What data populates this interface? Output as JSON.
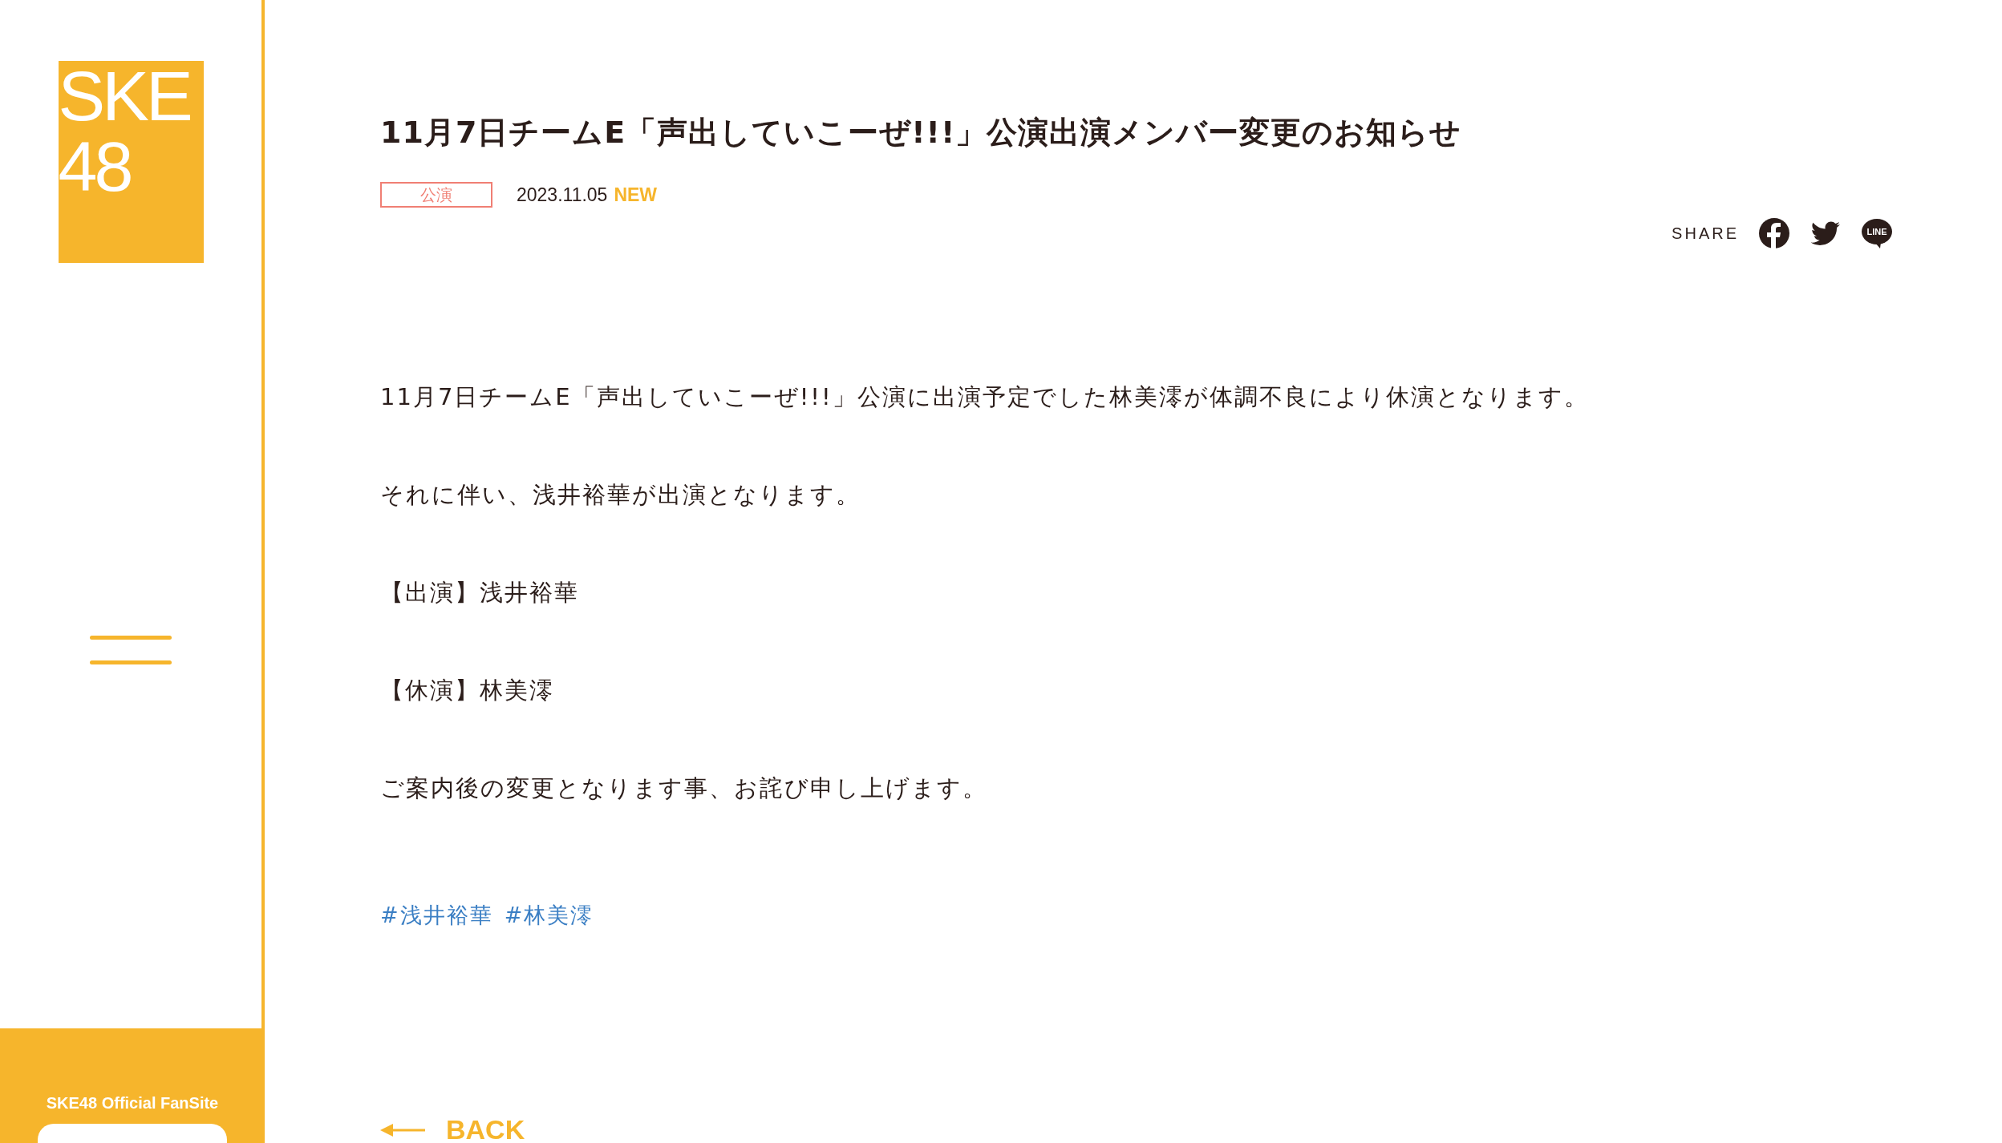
{
  "sidebar": {
    "logo_lines": [
      "SKE",
      "48"
    ],
    "footer_title": "SKE48 Official FanSite"
  },
  "article": {
    "title": "11月7日チームE「声出していこーぜ!!!」公演出演メンバー変更のお知らせ",
    "category": "公演",
    "date": "2023.11.05",
    "new_badge": "NEW"
  },
  "share": {
    "label": "SHARE",
    "icons": [
      {
        "kind": "facebook"
      },
      {
        "kind": "twitter"
      },
      {
        "kind": "line",
        "label": "LINE"
      }
    ]
  },
  "paragraphs": [
    "11月7日チームE「声出していこーぜ!!!」公演に出演予定でした林美澪が体調不良により休演となります。",
    "それに伴い、浅井裕華が出演となります。",
    "【出演】浅井裕華",
    "【休演】林美澪",
    "ご案内後の変更となります事、お詫び申し上げます。"
  ],
  "tags": [
    "#浅井裕華",
    "#林美澪"
  ],
  "back": "BACK"
}
